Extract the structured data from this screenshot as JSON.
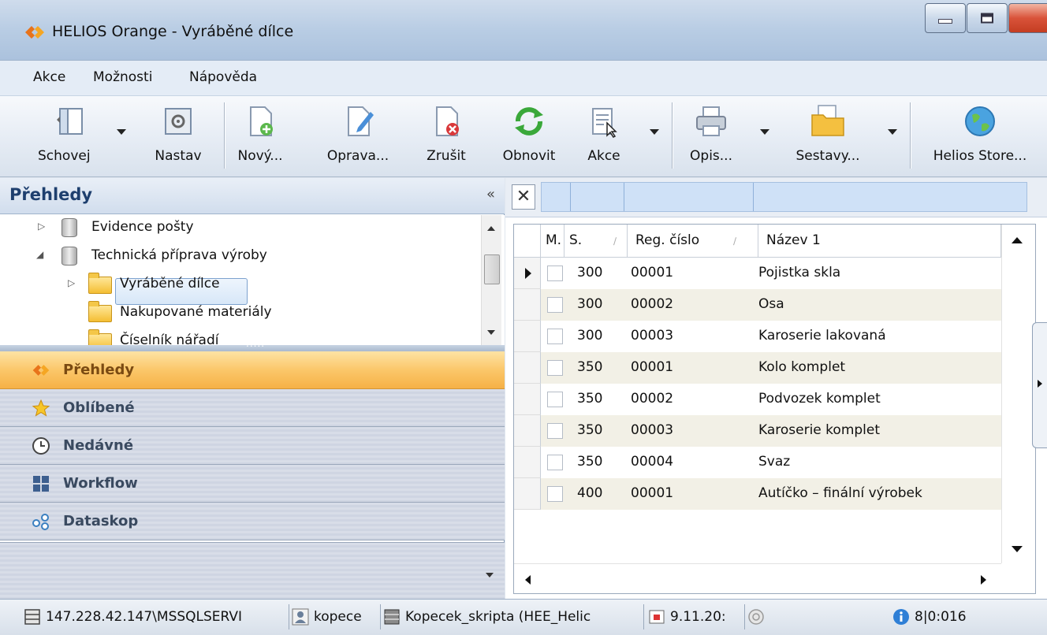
{
  "window": {
    "title": "HELIOS Orange - Vyráběné dílce"
  },
  "menu": {
    "items": [
      "Akce",
      "Možnosti",
      "Nápověda"
    ]
  },
  "toolbar": {
    "buttons": [
      {
        "label": "Schovej",
        "icon": "hide-panel-icon"
      },
      {
        "label": "Nastav",
        "icon": "settings-icon"
      },
      {
        "label": "Nový...",
        "icon": "new-document-icon"
      },
      {
        "label": "Oprava...",
        "icon": "edit-document-icon"
      },
      {
        "label": "Zrušit",
        "icon": "delete-document-icon"
      },
      {
        "label": "Obnovit",
        "icon": "refresh-icon"
      },
      {
        "label": "Akce",
        "icon": "actions-icon"
      },
      {
        "label": "Opis...",
        "icon": "print-icon"
      },
      {
        "label": "Sestavy...",
        "icon": "reports-folder-icon"
      },
      {
        "label": "Helios Store...",
        "icon": "globe-icon"
      }
    ]
  },
  "left_panel": {
    "title": "Přehledy",
    "collapse_glyph": "«",
    "tree": [
      {
        "label": "Evidence pošty",
        "type": "database",
        "expand": "▷"
      },
      {
        "label": "Technická příprava výroby",
        "type": "database",
        "expand": "◢"
      },
      {
        "label": "Vyráběné dílce",
        "type": "folder",
        "expand": "▷",
        "selected": true
      },
      {
        "label": "Nakupované materiály",
        "type": "folder"
      },
      {
        "label": "Číselník nářadí",
        "type": "folder"
      }
    ],
    "nav": [
      {
        "label": "Přehledy",
        "icon": "helios-logo-icon",
        "active": true
      },
      {
        "label": "Oblíbené",
        "icon": "star-icon"
      },
      {
        "label": "Nedávné",
        "icon": "clock-icon"
      },
      {
        "label": "Workflow",
        "icon": "workflow-icon"
      },
      {
        "label": "Dataskop",
        "icon": "dataskop-icon"
      }
    ]
  },
  "grid": {
    "filter_clear": "✕",
    "columns": [
      {
        "label": "M."
      },
      {
        "label": "S.",
        "sort": "∕"
      },
      {
        "label": "Reg. číslo",
        "sort": "∕"
      },
      {
        "label": "Název 1"
      }
    ],
    "rows": [
      {
        "s": "300",
        "reg": "00001",
        "name": "Pojistka skla",
        "current": true
      },
      {
        "s": "300",
        "reg": "00002",
        "name": "Osa"
      },
      {
        "s": "300",
        "reg": "00003",
        "name": "Karoserie lakovaná"
      },
      {
        "s": "350",
        "reg": "00001",
        "name": "Kolo komplet"
      },
      {
        "s": "350",
        "reg": "00002",
        "name": "Podvozek komplet"
      },
      {
        "s": "350",
        "reg": "00003",
        "name": "Karoserie komplet"
      },
      {
        "s": "350",
        "reg": "00004",
        "name": "Svaz"
      },
      {
        "s": "400",
        "reg": "00001",
        "name": "Autíčko – finální výrobek"
      }
    ]
  },
  "status": {
    "server": "147.228.42.147\\MSSQLSERVI",
    "user": "kopece",
    "database": "Kopecek_skripta (HEE_Helic",
    "date": "9.11.20:",
    "info": "8|0:016"
  },
  "colors": {
    "accent_orange": "#f6b146",
    "header_blue": "#1e3f6e",
    "filter_blue": "#cfe1f7"
  }
}
